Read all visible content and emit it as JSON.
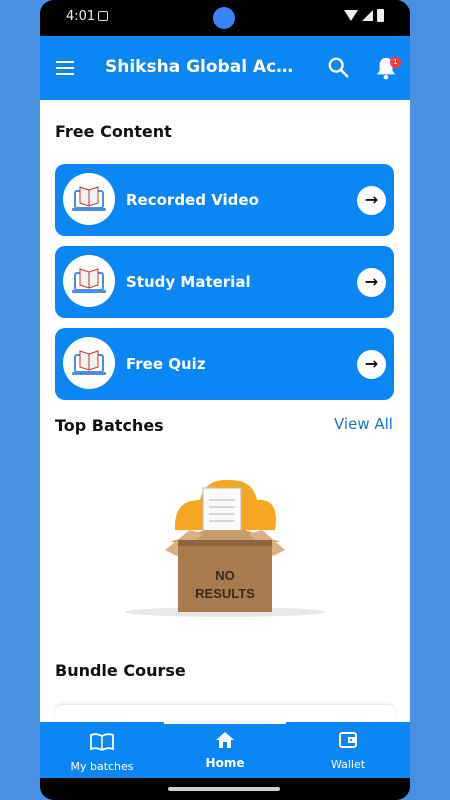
{
  "status_bar": {
    "time": "4:01"
  },
  "app_bar": {
    "title": "Shiksha Global Acad…",
    "notification_count": "1",
    "icons": [
      "menu-icon",
      "search-icon",
      "bell-icon"
    ]
  },
  "free_content": {
    "title": "Free Content",
    "items": [
      {
        "label": "Recorded Video",
        "icon": "book-laptop-icon"
      },
      {
        "label": "Study Material",
        "icon": "book-laptop-icon"
      },
      {
        "label": "Free Quiz",
        "icon": "book-laptop-icon"
      }
    ]
  },
  "top_batches": {
    "title": "Top Batches",
    "view_all": "View All",
    "empty_state_line1": "NO",
    "empty_state_line2": "RESULTS"
  },
  "bundle_course": {
    "title": "Bundle Course"
  },
  "bottom_nav": {
    "items": [
      {
        "label": "My batches",
        "icon": "book-icon"
      },
      {
        "label": "Home",
        "icon": "home-icon"
      },
      {
        "label": "Wallet",
        "icon": "wallet-icon"
      }
    ],
    "active": "Home"
  },
  "colors": {
    "primary": "#0d86f5",
    "background": "#4a90e2",
    "badge": "#ff3b30"
  }
}
